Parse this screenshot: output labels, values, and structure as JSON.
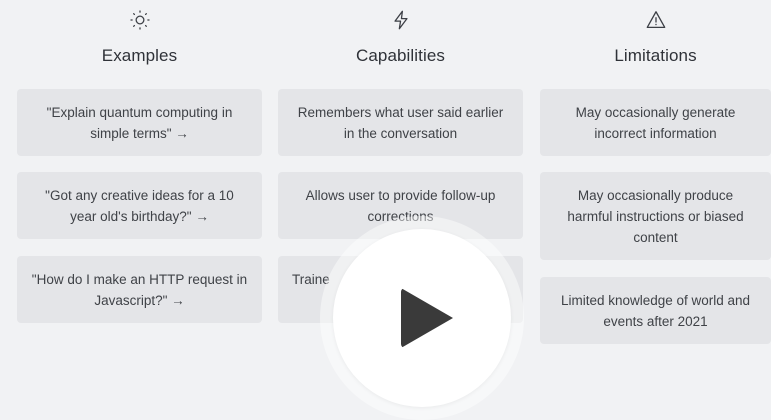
{
  "columns": [
    {
      "title": "Examples",
      "icon": "sun-icon",
      "cards": [
        "\"Explain quantum computing in simple terms\" →",
        "\"Got any creative ideas for a 10 year old's birthday?\" →",
        "\"How do I make an HTTP request in Javascript?\" →"
      ]
    },
    {
      "title": "Capabilities",
      "icon": "lightning-icon",
      "cards": [
        "Remembers what user said earlier in the conversation",
        "Allows user to provide follow-up corrections",
        "Traine                              e"
      ]
    },
    {
      "title": "Limitations",
      "icon": "warning-icon",
      "cards": [
        "May occasionally generate incorrect information",
        "May occasionally produce harmful instructions or biased content",
        "Limited knowledge of world and events after 2021"
      ]
    }
  ],
  "overlay": {
    "icon": "play-icon"
  }
}
